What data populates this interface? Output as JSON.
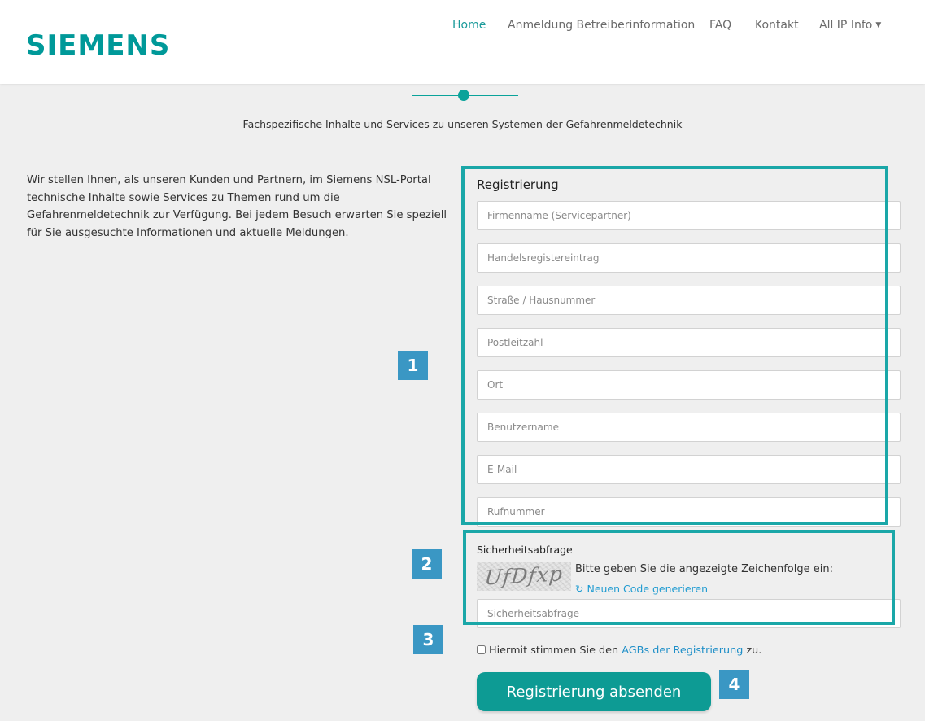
{
  "header": {
    "logo": "SIEMENS",
    "nav": [
      {
        "label": "Home",
        "active": true
      },
      {
        "label": "Anmeldung Betreiberinformation"
      },
      {
        "label": "FAQ"
      },
      {
        "label": "Kontakt"
      },
      {
        "label": "All IP Info",
        "dropdown": true
      }
    ]
  },
  "page": {
    "subtitle": "Fachspezifische Inhalte und Services zu unseren Systemen der Gefahrenmeldetechnik",
    "intro": "Wir stellen Ihnen, als unseren Kunden und Partnern, im Siemens NSL-Portal technische Inhalte sowie Services zu Themen rund um die Gefahrenmeldetechnik zur Verfügung. Bei jedem Besuch erwarten Sie speziell für Sie ausgesuchte Informationen und aktuelle Meldungen."
  },
  "form": {
    "title": "Registrierung",
    "fields": [
      {
        "placeholder": "Firmenname (Servicepartner)",
        "value": ""
      },
      {
        "placeholder": "Handelsregistereintrag",
        "value": ""
      },
      {
        "placeholder": "Straße / Hausnummer",
        "value": ""
      },
      {
        "placeholder": "Postleitzahl",
        "value": ""
      },
      {
        "placeholder": "Ort",
        "value": ""
      },
      {
        "placeholder": "Benutzername",
        "value": ""
      },
      {
        "placeholder": "E-Mail",
        "value": ""
      },
      {
        "placeholder": "Rufnummer",
        "value": ""
      }
    ],
    "security": {
      "title": "Sicherheitsabfrage",
      "captcha_text": "UfDfxp",
      "hint": "Bitte geben Sie die angezeigte Zeichenfolge ein:",
      "regenerate_icon": "refresh-icon",
      "regenerate_glyph": "↻",
      "regenerate_label": "Neuen Code generieren",
      "input_placeholder": "Sicherheitsabfrage"
    },
    "agb": {
      "checked": false,
      "prefix": "Hiermit stimmen Sie den",
      "link": "AGBs der Registrierung",
      "suffix": "zu."
    },
    "submit_label": "Registrierung absenden"
  },
  "annotations": {
    "badges": [
      "1",
      "2",
      "3",
      "4"
    ]
  },
  "colors": {
    "brand": "#009999",
    "accent": "#0d9b94",
    "link": "#1f9bd1",
    "annotation_box": "#1aa7a8",
    "badge": "#3a97c4",
    "background": "#efefef"
  }
}
